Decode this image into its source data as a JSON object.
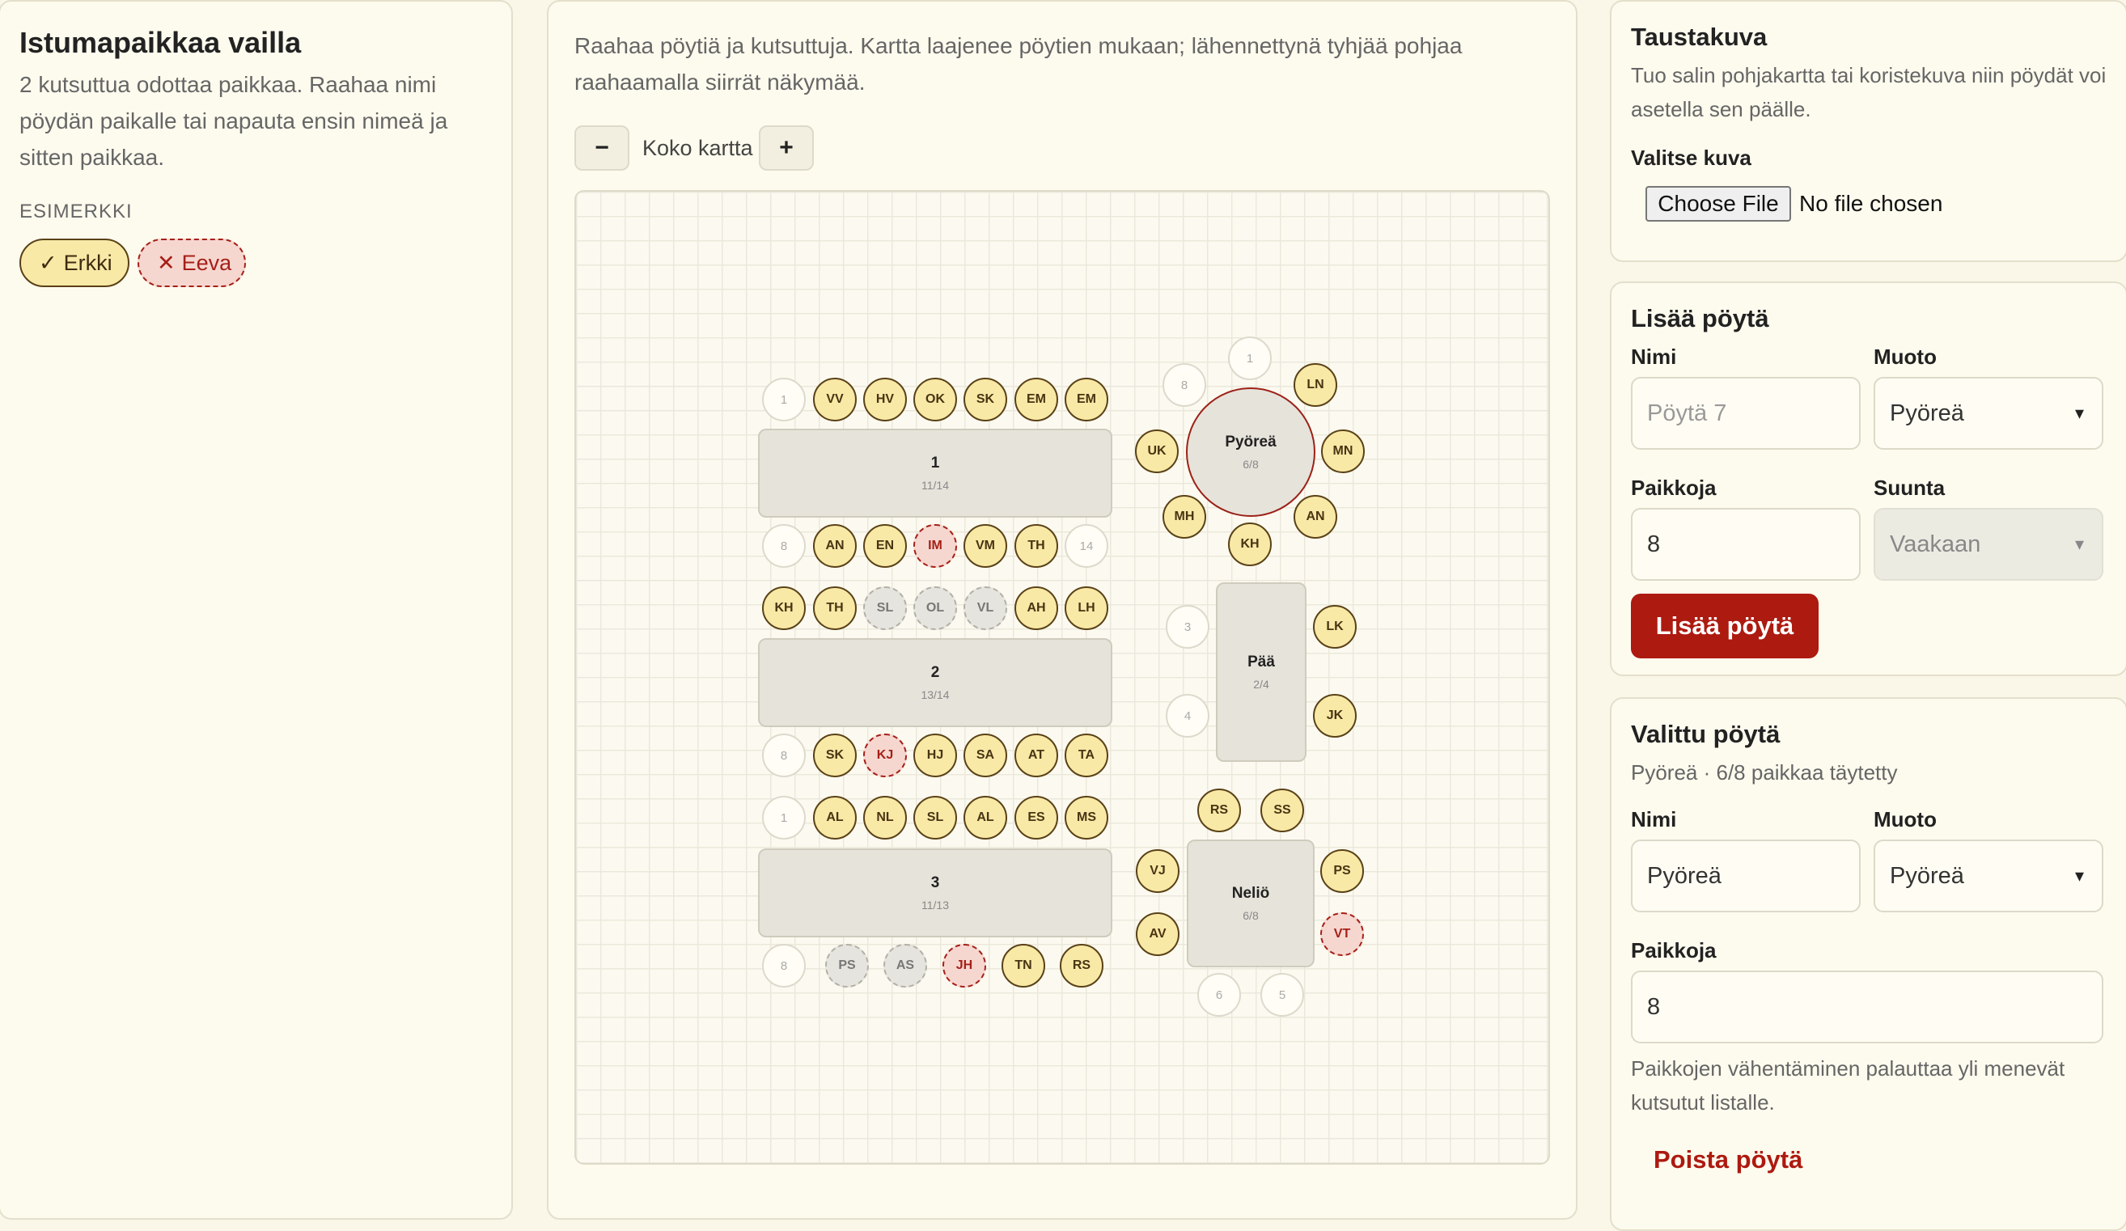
{
  "unseated": {
    "title": "Istumapaikkaa vailla",
    "description": "2 kutsuttua odottaa paikkaa. Raahaa nimi pöydän paikalle tai napauta ensin nimeä ja sitten paikkaa.",
    "example_label": "ESIMERKKI",
    "chip_ok": {
      "icon": "✓",
      "name": "Erkki"
    },
    "chip_bad": {
      "icon": "✕",
      "name": "Eeva"
    }
  },
  "map": {
    "instructions": "Raahaa pöytiä ja kutsuttuja. Kartta laajenee pöytien mukaan; lähennettynä tyhjää pohjaa raahaamalla siirrät näkymää.",
    "zoom_out": "−",
    "zoom_label": "Koko kartta",
    "zoom_in": "+",
    "tables": [
      {
        "name": "1",
        "count": "11/14"
      },
      {
        "name": "2",
        "count": "13/14"
      },
      {
        "name": "3",
        "count": "11/13"
      },
      {
        "name": "Pyöreä",
        "count": "6/8"
      },
      {
        "name": "Pää",
        "count": "2/4"
      },
      {
        "name": "Neliö",
        "count": "6/8"
      }
    ],
    "seats": {
      "t1_top": [
        "1",
        "VV",
        "HV",
        "OK",
        "SK",
        "EM",
        "EM"
      ],
      "t1_bottom": [
        "8",
        "AN",
        "EN",
        "IM",
        "VM",
        "TH",
        "14"
      ],
      "t2_top": [
        "KH",
        "TH",
        "SL",
        "OL",
        "VL",
        "AH",
        "LH"
      ],
      "t2_bottom": [
        "8",
        "SK",
        "KJ",
        "HJ",
        "SA",
        "AT",
        "TA"
      ],
      "t3_top": [
        "1",
        "AL",
        "NL",
        "SL",
        "AL",
        "ES",
        "MS"
      ],
      "t3_bottom": [
        "8",
        "PS",
        "AS",
        "JH",
        "TN",
        "RS"
      ],
      "round": [
        "1",
        "LN",
        "MN",
        "AN",
        "KH",
        "MH",
        "UK",
        "8"
      ],
      "head": [
        "3",
        "4",
        "LK",
        "JK"
      ],
      "square": [
        "RS",
        "SS",
        "PS",
        "VT",
        "5",
        "6",
        "AV",
        "VJ"
      ]
    },
    "seat_states": {
      "filled": "#f8e9a6",
      "conflict": "#f6d7d0",
      "pending": "#e6e4de",
      "empty": "#fffdf5"
    }
  },
  "background": {
    "title": "Taustakuva",
    "description": "Tuo salin pohjakartta tai koristekuva niin pöydät voi asetella sen päälle.",
    "choose_label": "Valitse kuva",
    "file_button": "Choose File",
    "file_status": "No file chosen"
  },
  "add_table": {
    "title": "Lisää pöytä",
    "name_label": "Nimi",
    "name_placeholder": "Pöytä 7",
    "shape_label": "Muoto",
    "shape_value": "Pyöreä",
    "seats_label": "Paikkoja",
    "seats_value": "8",
    "direction_label": "Suunta",
    "direction_value": "Vaakaan",
    "submit": "Lisää pöytä"
  },
  "selected_table": {
    "title": "Valittu pöytä",
    "summary": "Pyöreä · 6/8 paikkaa täytetty",
    "name_label": "Nimi",
    "name_value": "Pyöreä",
    "shape_label": "Muoto",
    "shape_value": "Pyöreä",
    "seats_label": "Paikkoja",
    "seats_value": "8",
    "note": "Paikkojen vähentäminen palauttaa yli menevät kutsutut listalle.",
    "delete": "Poista pöytä"
  },
  "colors": {
    "accent": "#ad1a10",
    "background": "#faf7e8"
  }
}
